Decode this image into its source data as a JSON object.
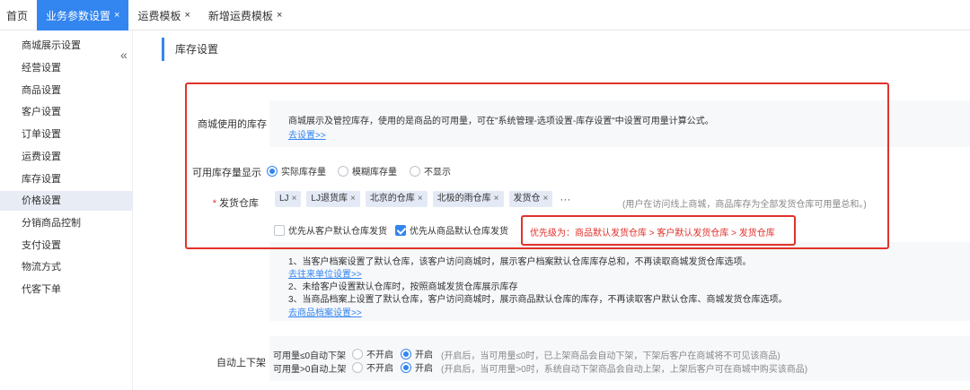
{
  "tabs": [
    {
      "label": "首页",
      "close": ""
    },
    {
      "label": "业务参数设置",
      "close": "×"
    },
    {
      "label": "运费模板",
      "close": "×"
    },
    {
      "label": "新增运费模板",
      "close": "×"
    }
  ],
  "sidebar": {
    "collapse_icon": "«",
    "items": [
      "商城展示设置",
      "经营设置",
      "商品设置",
      "客户设置",
      "订单设置",
      "运费设置",
      "库存设置",
      "价格设置",
      "分销商品控制",
      "支付设置",
      "物流方式",
      "代客下单"
    ],
    "active_index": 7
  },
  "section_title": "库存设置",
  "stock_source": {
    "label": "商城使用的库存",
    "description": "商城展示及管控库存，使用的是商品的可用量，可在\"系统管理-选项设置-库存设置\"中设置可用量计算公式。",
    "link": "去设置>>"
  },
  "stock_display": {
    "label": "可用库存量显示",
    "options": [
      "实际库存量",
      "模糊库存量",
      "不显示"
    ],
    "selected": 0
  },
  "warehouse": {
    "required_mark": "*",
    "label": "发货仓库",
    "tags": [
      "LJ",
      "LJ退货库",
      "北京的仓库",
      "北极的雨仓库",
      "发货仓"
    ],
    "tag_close": "×",
    "more": "···",
    "hint": "(用户在访问线上商城，商品库存为全部发货仓库可用量总和。)",
    "check_customer": "优先从客户默认仓库发货",
    "check_product": "优先从商品默认仓库发货",
    "check_customer_on": false,
    "check_product_on": true,
    "priority_text": "优先级为：商品默认发货仓库 > 客户默认发货仓库 > 发货仓库"
  },
  "notes": {
    "line1": "1、当客户档案设置了默认仓库，该客户访问商城时，展示客户档案默认仓库库存总和，不再读取商城发货仓库选项。",
    "link1": "去往来单位设置>>",
    "line2": "2、未给客户设置默认仓库时，按照商城发货仓库展示库存",
    "line3": "3、当商品档案上设置了默认仓库，客户访问商城时，展示商品默认仓库的库存，不再读取客户默认仓库、商城发货仓库选项。",
    "link3": "去商品档案设置>>"
  },
  "auto_shelf": {
    "label": "自动上下架",
    "row1_label": "可用量≤0自动下架",
    "row2_label": "可用量>0自动上架",
    "off": "不开启",
    "on": "开启",
    "row1_note": "(开启后，当可用量≤0时，已上架商品会自动下架，下架后客户在商城将不可见该商品)",
    "row2_note": "(开启后，当可用量>0时，系统自动下架商品会自动上架，上架后客户可在商城中购买该商品)"
  }
}
